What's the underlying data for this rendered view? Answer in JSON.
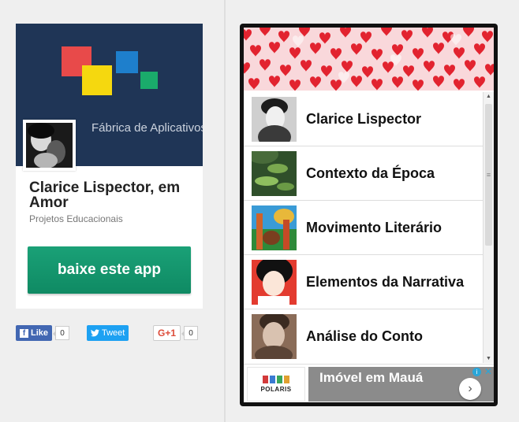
{
  "store": {
    "banner_text": "Fábrica de Aplicativos",
    "app_title": "Clarice Lispector, em Amor",
    "app_developer": "Projetos Educacionais",
    "download_label": "baixe este app",
    "brand_colors": {
      "red": "#e84a4a",
      "yellow": "#f5d80f",
      "blue": "#1e7fcc",
      "green": "#1aab6b"
    }
  },
  "social": {
    "like_label": "Like",
    "like_count": "0",
    "tweet_label": "Tweet",
    "gplus_label": "G+1",
    "gplus_count": "0"
  },
  "phone": {
    "menu_items": [
      {
        "label": "Clarice Lispector",
        "icon": "portrait-photo"
      },
      {
        "label": "Contexto da Época",
        "icon": "water-lilies-painting"
      },
      {
        "label": "Movimento Literário",
        "icon": "tropical-painting"
      },
      {
        "label": "Elementos da Narrativa",
        "icon": "woman-illustration"
      },
      {
        "label": "Análise do Conto",
        "icon": "woman-photo"
      }
    ],
    "ad": {
      "brand": "POLARIS",
      "text": "Imóvel em Mauá"
    }
  }
}
